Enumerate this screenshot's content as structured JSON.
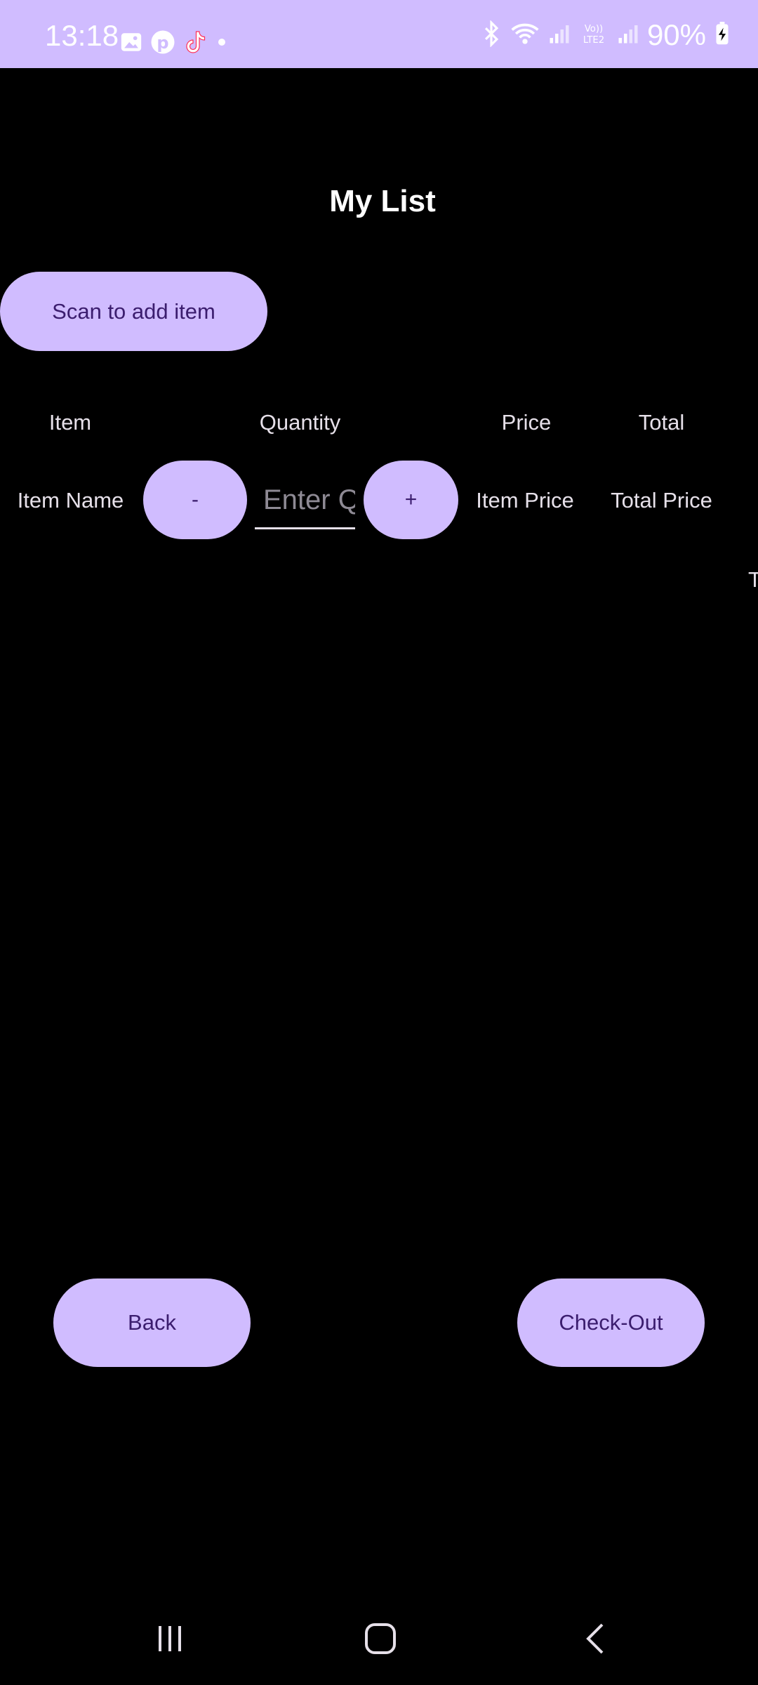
{
  "status_bar": {
    "time": "13:18",
    "battery": "90%",
    "left_icons": [
      "gallery-icon",
      "pinterest-icon",
      "tiktok-icon",
      "dot-icon"
    ],
    "right_icons": [
      "bluetooth-icon",
      "wifi-icon",
      "signal-icon",
      "volte-icon",
      "signal-icon",
      "battery-charging-icon"
    ],
    "background": "#d0bcff"
  },
  "page": {
    "title": "My List",
    "background": "#000000"
  },
  "scan_button": {
    "label": "Scan to add item"
  },
  "table": {
    "headers": {
      "item": "Item",
      "quantity": "Quantity",
      "price": "Price",
      "total": "Total"
    },
    "row": {
      "item_name": "Item Name",
      "minus_label": "-",
      "quantity_placeholder": "Enter Quantity",
      "plus_label": "+",
      "item_price": "Item Price",
      "total_price": "Total Price"
    },
    "overflow_text": "T"
  },
  "footer": {
    "back_label": "Back",
    "checkout_label": "Check-Out"
  },
  "nav_bar": {
    "buttons": [
      "recent-apps-icon",
      "home-icon",
      "back-icon"
    ]
  },
  "colors": {
    "accent": "#d0bcff",
    "button_text": "#3b1d6e",
    "text": "#e6e0e9"
  }
}
